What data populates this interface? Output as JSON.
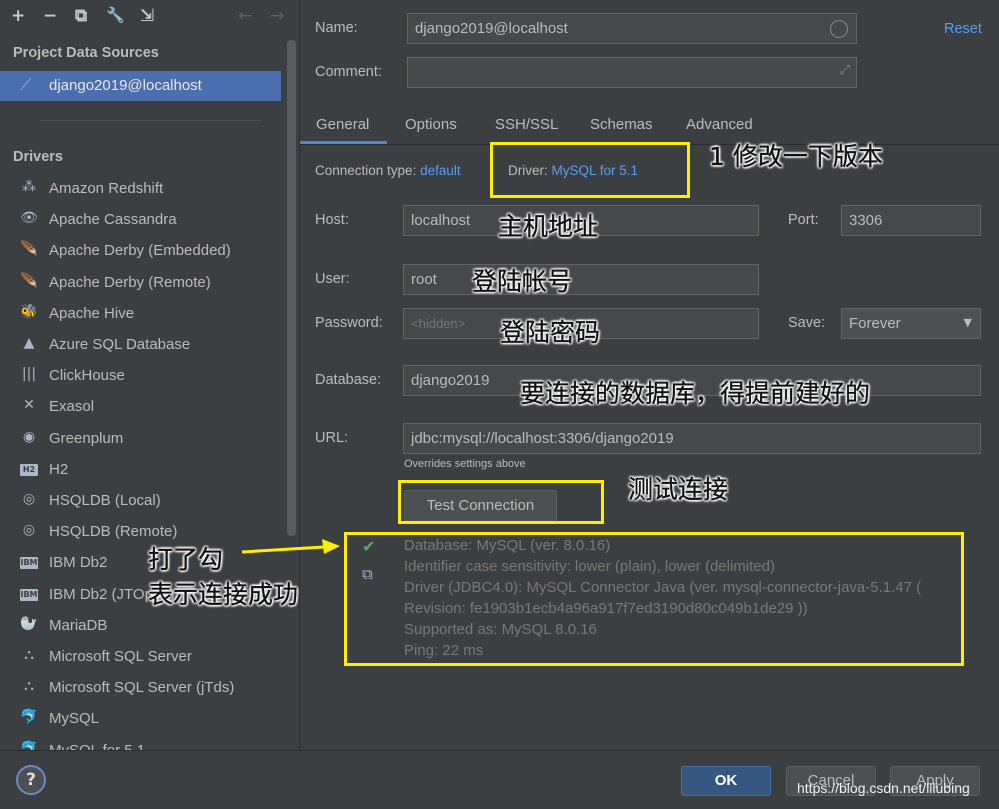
{
  "toolbar": {
    "add": "+",
    "remove": "−",
    "duplicate": "⧉",
    "properties": "🔧",
    "import": "⇲",
    "back": "←",
    "forward": "→"
  },
  "left": {
    "project_title": "Project Data Sources",
    "selected_source": "django2019@localhost",
    "drivers_title": "Drivers",
    "drivers": [
      {
        "label": "Amazon Redshift",
        "icon": "redshift-icon",
        "glyph": "⁂"
      },
      {
        "label": "Apache Cassandra",
        "icon": "cassandra-icon",
        "glyph": "👁"
      },
      {
        "label": "Apache Derby (Embedded)",
        "icon": "derby-icon",
        "glyph": "🪶"
      },
      {
        "label": "Apache Derby (Remote)",
        "icon": "derby-icon",
        "glyph": "🪶"
      },
      {
        "label": "Apache Hive",
        "icon": "hive-icon",
        "glyph": "🐝"
      },
      {
        "label": "Azure SQL Database",
        "icon": "azure-icon",
        "glyph": "▲"
      },
      {
        "label": "ClickHouse",
        "icon": "clickhouse-icon",
        "glyph": "|||"
      },
      {
        "label": "Exasol",
        "icon": "exasol-icon",
        "glyph": "✕"
      },
      {
        "label": "Greenplum",
        "icon": "greenplum-icon",
        "glyph": "◉"
      },
      {
        "label": "H2",
        "icon": "h2-icon",
        "glyph": "H2"
      },
      {
        "label": "HSQLDB (Local)",
        "icon": "hsqldb-icon",
        "glyph": "◎"
      },
      {
        "label": "HSQLDB (Remote)",
        "icon": "hsqldb-icon",
        "glyph": "◎"
      },
      {
        "label": "IBM Db2",
        "icon": "ibm-icon",
        "glyph": "IBM"
      },
      {
        "label": "IBM Db2 (JTOpen)",
        "icon": "ibm-icon",
        "glyph": "IBM"
      },
      {
        "label": "MariaDB",
        "icon": "mariadb-icon",
        "glyph": "🦭"
      },
      {
        "label": "Microsoft SQL Server",
        "icon": "mssql-icon",
        "glyph": "⛬"
      },
      {
        "label": "Microsoft SQL Server (jTds)",
        "icon": "mssql-icon",
        "glyph": "⛬"
      },
      {
        "label": "MySQL",
        "icon": "mysql-icon",
        "glyph": "🐬"
      },
      {
        "label": "MySQL for 5.1",
        "icon": "mysql-icon",
        "glyph": "🐬"
      }
    ]
  },
  "form": {
    "name_label": "Name:",
    "name_value": "django2019@localhost",
    "reset": "Reset",
    "comment_label": "Comment:",
    "comment_value": "",
    "tabs": [
      "General",
      "Options",
      "SSH/SSL",
      "Schemas",
      "Advanced"
    ],
    "conn_type_label": "Connection type:",
    "conn_type_value": "default",
    "driver_label": "Driver:",
    "driver_value": "MySQL for 5.1",
    "host_label": "Host:",
    "host_value": "localhost",
    "port_label": "Port:",
    "port_value": "3306",
    "user_label": "User:",
    "user_value": "root",
    "password_label": "Password:",
    "password_value": "<hidden>",
    "save_label": "Save:",
    "save_value": "Forever",
    "database_label": "Database:",
    "database_value": "django2019",
    "url_label": "URL:",
    "url_value": "jdbc:mysql://localhost:3306/django2019",
    "url_hint": "Overrides settings above",
    "test_button": "Test Connection"
  },
  "status": {
    "lines": [
      "Database: MySQL (ver. 8.0.16)",
      "Identifier case sensitivity: lower (plain), lower (delimited)",
      "Driver (JDBC4.0): MySQL Connector Java (ver. mysql-connector-java-5.1.47 (",
      "Revision: fe1903b1ecb4a96a917f7ed3190d80c049b1de29 ))",
      "Supported as: MySQL 8.0.16",
      "Ping: 22 ms"
    ]
  },
  "annotations": {
    "version": "1 修改一下版本",
    "host": "主机地址",
    "user": "登陆帐号",
    "password": "登陆密码",
    "database": "要连接的数据库，得提前建好的",
    "test": "测试连接",
    "check1": "打了勾",
    "check2": "表示连接成功"
  },
  "footer": {
    "help": "?",
    "ok": "OK",
    "cancel": "Cancel",
    "apply": "Apply",
    "watermark": "https://blog.csdn.net/lilubing"
  },
  "colors": {
    "accent": "#4b6eaf",
    "link": "#589df6",
    "highlight": "#ffee00",
    "success": "#59a869"
  }
}
